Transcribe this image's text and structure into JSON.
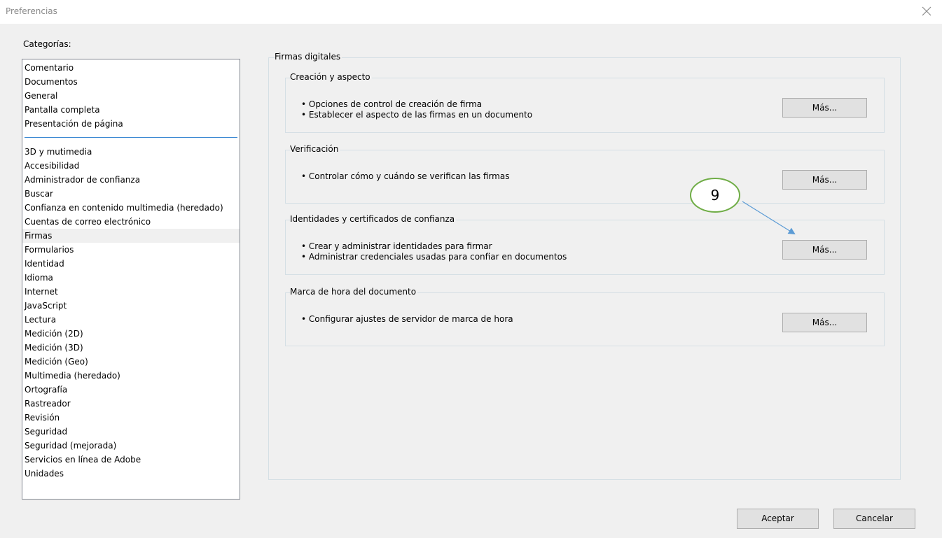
{
  "window": {
    "title": "Preferencias",
    "close_icon": "close-icon"
  },
  "categories": {
    "label": "Categorías:",
    "top_items": [
      "Comentario",
      "Documentos",
      "General",
      "Pantalla completa",
      "Presentación de página"
    ],
    "items": [
      "3D y mutimedia",
      "Accesibilidad",
      "Administrador de confianza",
      "Buscar",
      "Confianza en contenido multimedia (heredado)",
      "Cuentas de correo electrónico",
      "Firmas",
      "Formularios",
      "Identidad",
      "Idioma",
      "Internet",
      "JavaScript",
      "Lectura",
      "Medición (2D)",
      "Medición (3D)",
      "Medición (Geo)",
      "Multimedia (heredado)",
      "Ortografía",
      "Rastreador",
      "Revisión",
      "Seguridad",
      "Seguridad (mejorada)",
      "Servicios en línea de Adobe",
      "Unidades"
    ],
    "selected": "Firmas"
  },
  "panel": {
    "title": "Firmas digitales",
    "sections": [
      {
        "title": "Creación y aspecto",
        "bullets": [
          "• Opciones de control de creación de firma",
          "• Establecer el aspecto de las firmas en un documento"
        ],
        "button": "Más..."
      },
      {
        "title": "Verificación",
        "bullets": [
          "• Controlar cómo y cuándo se verifican las firmas"
        ],
        "button": "Más..."
      },
      {
        "title": "Identidades y certificados de confianza",
        "bullets": [
          "• Crear y administrar identidades para firmar",
          "• Administrar credenciales usadas para confiar en documentos"
        ],
        "button": "Más..."
      },
      {
        "title": "Marca de hora del documento",
        "bullets": [
          "• Configurar ajustes de servidor de marca de hora"
        ],
        "button": "Más..."
      }
    ]
  },
  "annotation": {
    "number": "9",
    "color_circle": "#70ad47",
    "color_arrow": "#5b9bd5"
  },
  "footer": {
    "ok": "Aceptar",
    "cancel": "Cancelar"
  }
}
